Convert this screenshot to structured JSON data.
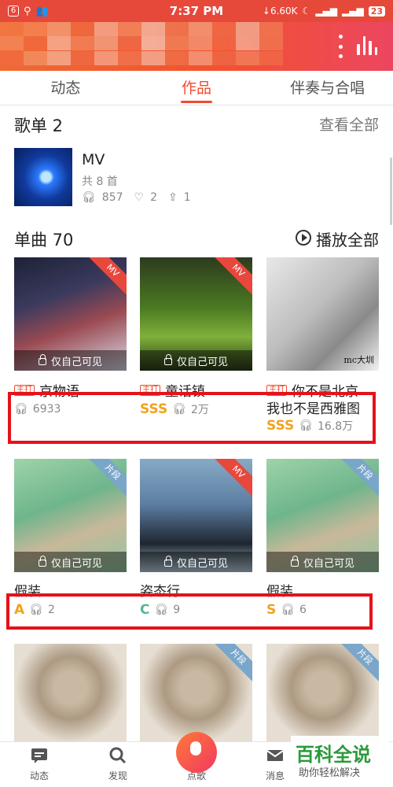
{
  "status_bar": {
    "time": "7:37 PM",
    "speed": "↓6.60K",
    "battery": "23",
    "box_label": "6"
  },
  "tabs": [
    "动态",
    "作品",
    "伴奏与合唱"
  ],
  "playlists": {
    "title": "歌单 2",
    "see_all": "查看全部",
    "item": {
      "title": "MV",
      "count": "共 8 首",
      "listens": "857",
      "likes": "2",
      "shares": "1"
    }
  },
  "singles": {
    "title": "单曲 70",
    "play_all": "播放全部",
    "private_label": "仅自己可见",
    "tag_label": "主打",
    "badge_mv": "MV",
    "badge_segment": "片段",
    "songs": [
      {
        "title": "京物语",
        "grade": "",
        "listens": "6933"
      },
      {
        "title": "童话镇",
        "grade": "SSS",
        "listens": "2万"
      },
      {
        "title": "你不是北京",
        "title2": "我也不是西雅图",
        "grade": "SSS",
        "listens": "16.8万"
      },
      {
        "title": "假装",
        "grade": "A",
        "listens": "2"
      },
      {
        "title": "姿态行",
        "grade": "C",
        "listens": "9"
      },
      {
        "title": "假装",
        "grade": "S",
        "listens": "6"
      }
    ],
    "art_caption": "mc大圳"
  },
  "bottom_nav": [
    "动态",
    "发现",
    "点歌",
    "消息"
  ],
  "watermark": {
    "big": "百科全说",
    "small": "助你轻松解决"
  },
  "colors": {
    "accent": "#f04a2c",
    "grade_gold": "#f2a21e",
    "grade_green": "#58b88a",
    "highlight_box": "#e5121a"
  }
}
